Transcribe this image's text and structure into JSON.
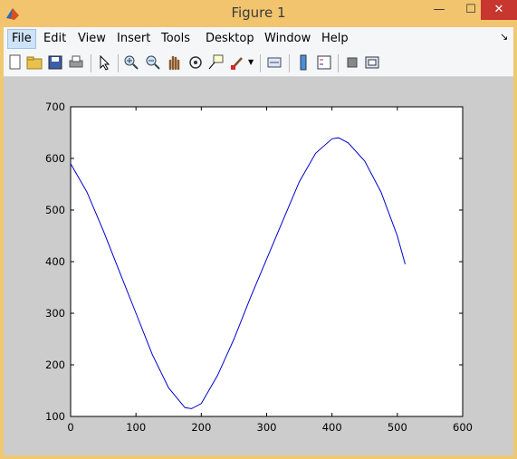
{
  "window": {
    "title": "Figure 1"
  },
  "menubar": {
    "items": [
      "File",
      "Edit",
      "View",
      "Insert",
      "Tools",
      "Desktop",
      "Window",
      "Help"
    ]
  },
  "toolbar": {
    "icons": [
      "new-figure-icon",
      "open-file-icon",
      "save-icon",
      "print-icon",
      "edit-plot-icon",
      "zoom-in-icon",
      "zoom-out-icon",
      "pan-icon",
      "rotate-3d-icon",
      "data-cursor-icon",
      "brush-icon",
      "link-plot-icon",
      "colorbar-icon",
      "legend-icon",
      "hide-plot-tools-icon",
      "show-plot-tools-icon"
    ]
  },
  "colors": {
    "line": "#0000cc",
    "figure_bg": "#cccccc",
    "title_bar": "#f2c46e"
  },
  "chart_data": {
    "type": "line",
    "xlim": [
      0,
      600
    ],
    "ylim": [
      100,
      700
    ],
    "x_ticks": [
      0,
      100,
      200,
      300,
      400,
      500,
      600
    ],
    "y_ticks": [
      100,
      200,
      300,
      400,
      500,
      600,
      700
    ],
    "grid": false,
    "series": [
      {
        "x": [
          0,
          25,
          50,
          75,
          100,
          125,
          150,
          175,
          185,
          200,
          225,
          250,
          275,
          300,
          325,
          350,
          375,
          400,
          410,
          425,
          450,
          475,
          500,
          512
        ],
        "y": [
          590,
          535,
          460,
          380,
          300,
          220,
          155,
          117,
          115,
          125,
          180,
          250,
          330,
          405,
          480,
          555,
          610,
          638,
          640,
          630,
          595,
          535,
          450,
          395
        ]
      }
    ]
  }
}
